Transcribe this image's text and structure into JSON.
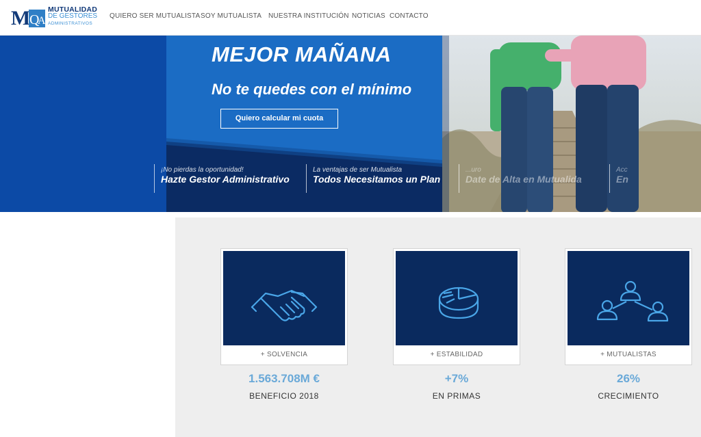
{
  "logo": {
    "line1": "MUTUALIDAD",
    "line2": "DE GESTORES",
    "line3": "ADMINISTRATIVOS"
  },
  "nav": [
    {
      "label": "QUIERO SER MUTUALISTA"
    },
    {
      "label": "SOY MUTUALISTA"
    },
    {
      "label": "NUESTRA INSTITUCIÓN"
    },
    {
      "label": "NOTICIAS"
    },
    {
      "label": "CONTACTO"
    }
  ],
  "hero": {
    "title": "MEJOR MAÑANA",
    "subtitle": "No te quedes con el mínimo",
    "button_label": "Quiero calcular mi cuota",
    "slides": [
      {
        "small": "¡No pierdas la oportunidad!",
        "big": "Hazte Gestor Administrativo"
      },
      {
        "small": "La ventajas de ser Mutualista",
        "big": "Todos Necesitamos un Plan"
      },
      {
        "small": "...uro",
        "big": "Date de Alta en Mutualida"
      },
      {
        "small": "Acc",
        "big": "En"
      }
    ]
  },
  "stats": [
    {
      "card_label": "+ SOLVENCIA",
      "value": "1.563.708M €",
      "caption": "BENEFICIO 2018",
      "icon": "handshake-icon"
    },
    {
      "card_label": "+ ESTABILIDAD",
      "value": "+7%",
      "caption": "EN PRIMAS",
      "icon": "pie-chart-icon"
    },
    {
      "card_label": "+ MUTUALISTAS",
      "value": "26%",
      "caption": "CRECIMIENTO",
      "icon": "people-network-icon"
    }
  ],
  "colors": {
    "brand_dark": "#123a79",
    "brand_light": "#3b8fd4",
    "icon_blue": "#4aa6e8",
    "card_bg": "#0a2a5e",
    "stat_value": "#6aa9d8"
  }
}
